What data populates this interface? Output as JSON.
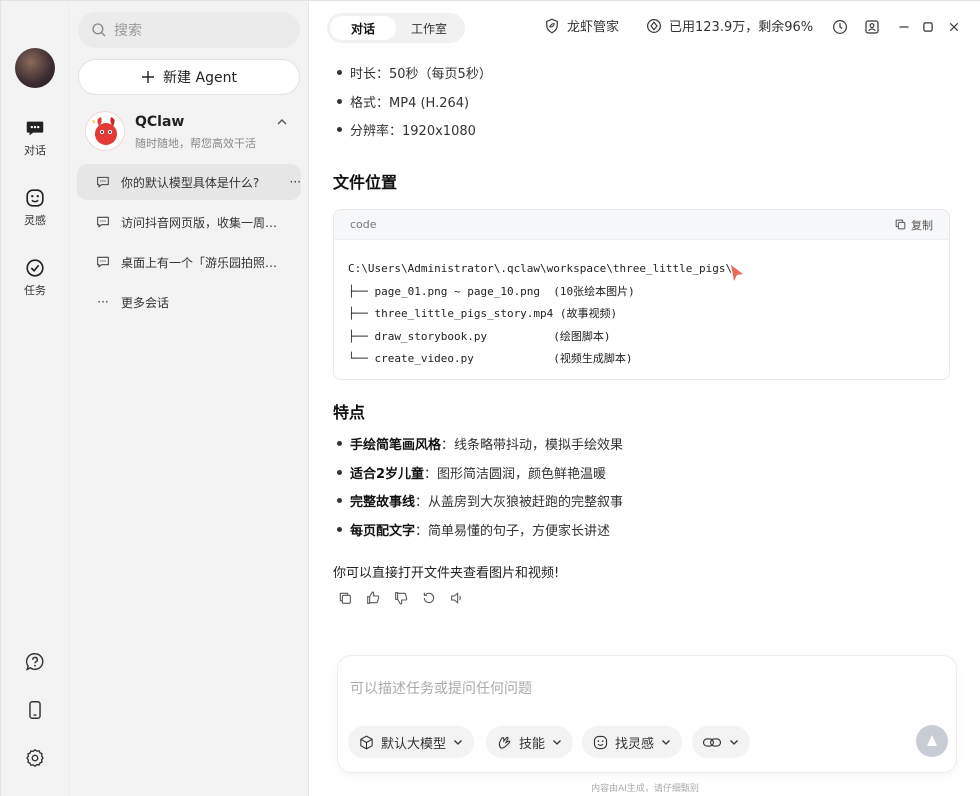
{
  "rail": {
    "items": [
      {
        "label": "对话",
        "icon": "chat-bubble-icon"
      },
      {
        "label": "灵感",
        "icon": "smiley-icon"
      },
      {
        "label": "任务",
        "icon": "check-circle-icon"
      }
    ],
    "bottom_icons": [
      "help-icon",
      "phone-icon",
      "settings-gear-icon"
    ]
  },
  "sidebar": {
    "search_placeholder": "搜索",
    "new_agent_label": "新建 Agent",
    "agent": {
      "name": "QClaw",
      "subtitle": "随时随地，帮您高效干活"
    },
    "conversations": [
      {
        "title": "你的默认模型具体是什么?",
        "more": "···"
      },
      {
        "title": "访问抖音网页版，收集一周…",
        "more": ""
      },
      {
        "title": "桌面上有一个「游乐园拍照…",
        "more": ""
      }
    ],
    "more_label": "更多会话"
  },
  "header": {
    "tabs": [
      "对话",
      "工作室"
    ],
    "active_tab": "对话",
    "manager_label": "龙虾管家",
    "usage_label": "已用123.9万，剩余96%"
  },
  "message": {
    "specs": [
      {
        "label": "时长",
        "value": "：50秒（每页5秒）"
      },
      {
        "label": "格式",
        "value": "：MP4 (H.264)"
      },
      {
        "label": "分辨率",
        "value": "：1920x1080"
      }
    ],
    "file_heading": "文件位置",
    "code": {
      "lang": "code",
      "copy_label": "复制",
      "text": "C:\\Users\\Administrator\\.qclaw\\workspace\\three_little_pigs\\\n├── page_01.png ~ page_10.png  (10张绘本图片)\n├── three_little_pigs_story.mp4 (故事视频)\n├── draw_storybook.py          (绘图脚本)\n└── create_video.py            (视频生成脚本)"
    },
    "features_heading": "特点",
    "features": [
      {
        "bold": "手绘简笔画风格",
        "text": "：线条略带抖动，模拟手绘效果"
      },
      {
        "bold": "适合2岁儿童",
        "text": "：图形简洁圆润，颜色鲜艳温暖"
      },
      {
        "bold": "完整故事线",
        "text": "：从盖房到大灰狼被赶跑的完整叙事"
      },
      {
        "bold": "每页配文字",
        "text": "：简单易懂的句子，方便家长讲述"
      }
    ],
    "closing": "你可以直接打开文件夹查看图片和视频!"
  },
  "composer": {
    "placeholder": "可以描述任务或提问任何问题",
    "model_label": "默认大模型",
    "skill_label": "技能",
    "inspire_label": "找灵感"
  },
  "footer": "内容由AI生成，请仔细甄别",
  "colors": {
    "accent": "#e53935",
    "rail_bg": "#f3f3f3",
    "send_bg": "#c8ccd4"
  }
}
